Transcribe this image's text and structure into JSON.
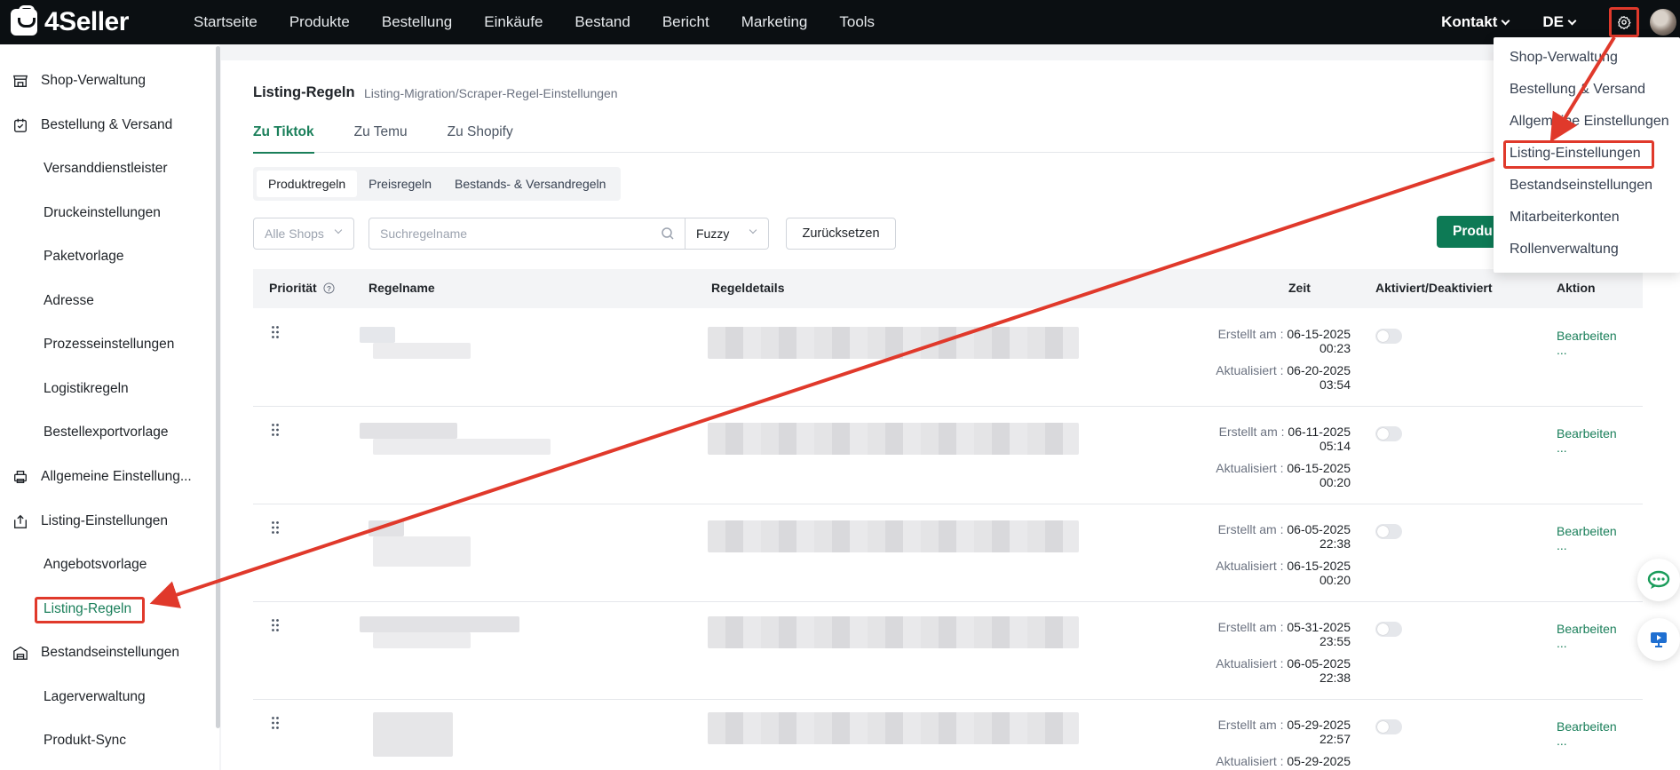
{
  "app": {
    "brand": "4Seller"
  },
  "nav": {
    "items": [
      "Startseite",
      "Produkte",
      "Bestellung",
      "Einkäufe",
      "Bestand",
      "Bericht",
      "Marketing",
      "Tools"
    ],
    "contact": "Kontakt",
    "language": "DE"
  },
  "sidebar": {
    "shop": "Shop-Verwaltung",
    "order": "Bestellung & Versand",
    "carriers": "Versanddienstleister",
    "print": "Druckeinstellungen",
    "package": "Paketvorlage",
    "address": "Adresse",
    "process": "Prozesseinstellungen",
    "logistics": "Logistikregeln",
    "export": "Bestellexportvorlage",
    "general": "Allgemeine Einstellung...",
    "listing": "Listing-Einstellungen",
    "offer": "Angebotsvorlage",
    "rules": "Listing-Regeln",
    "stock": "Bestandseinstellungen",
    "warehouse": "Lagerverwaltung",
    "sync": "Produkt-Sync"
  },
  "page": {
    "title": "Listing-Regeln",
    "subtitle": "Listing-Migration/Scraper-Regel-Einstellungen",
    "tabs": [
      "Zu Tiktok",
      "Zu Temu",
      "Zu Shopify"
    ],
    "segments": [
      "Produktregeln",
      "Preisregeln",
      "Bestands- & Versandregeln"
    ]
  },
  "filters": {
    "shops": "Alle Shops",
    "search_placeholder": "Suchregelname",
    "match": "Fuzzy",
    "reset": "Zurücksetzen",
    "primary": "Produ"
  },
  "table": {
    "columns": {
      "priority": "Priorität",
      "name": "Regelname",
      "details": "Regeldetails",
      "time": "Zeit",
      "status": "Aktiviert/Deaktiviert",
      "action": "Aktion"
    },
    "created_label": "Erstellt am :",
    "updated_label": "Aktualisiert :",
    "edit": "Bearbeiten",
    "more": "...",
    "rows": [
      {
        "created_date": "06-15-2025",
        "created_time": "00:23",
        "updated_date": "06-20-2025",
        "updated_time": "03:54",
        "enabled": false
      },
      {
        "created_date": "06-11-2025",
        "created_time": "05:14",
        "updated_date": "06-15-2025",
        "updated_time": "00:20",
        "enabled": false
      },
      {
        "created_date": "06-05-2025",
        "created_time": "22:38",
        "updated_date": "06-15-2025",
        "updated_time": "00:20",
        "enabled": false
      },
      {
        "created_date": "05-31-2025",
        "created_time": "23:55",
        "updated_date": "06-05-2025",
        "updated_time": "22:38",
        "enabled": false
      },
      {
        "created_date": "05-29-2025",
        "created_time": "22:57",
        "updated_date": "05-29-2025",
        "updated_time": "",
        "enabled": false
      }
    ]
  },
  "settings_menu": {
    "items": [
      "Shop-Verwaltung",
      "Bestellung & Versand",
      "Allgemeine Einstellungen",
      "Listing-Einstellungen",
      "Bestandseinstellungen",
      "Mitarbeiterkonten",
      "Rollenverwaltung"
    ],
    "highlighted": "Listing-Einstellungen"
  },
  "colors": {
    "accent": "#1a7f5a",
    "primary_button": "#0d7a55",
    "annotation": "#e0392b",
    "topbar": "#0b0f12"
  },
  "icons": [
    "gear-icon",
    "search-icon",
    "drag-handle-icon",
    "help-icon",
    "chat-icon",
    "screen-icon"
  ]
}
